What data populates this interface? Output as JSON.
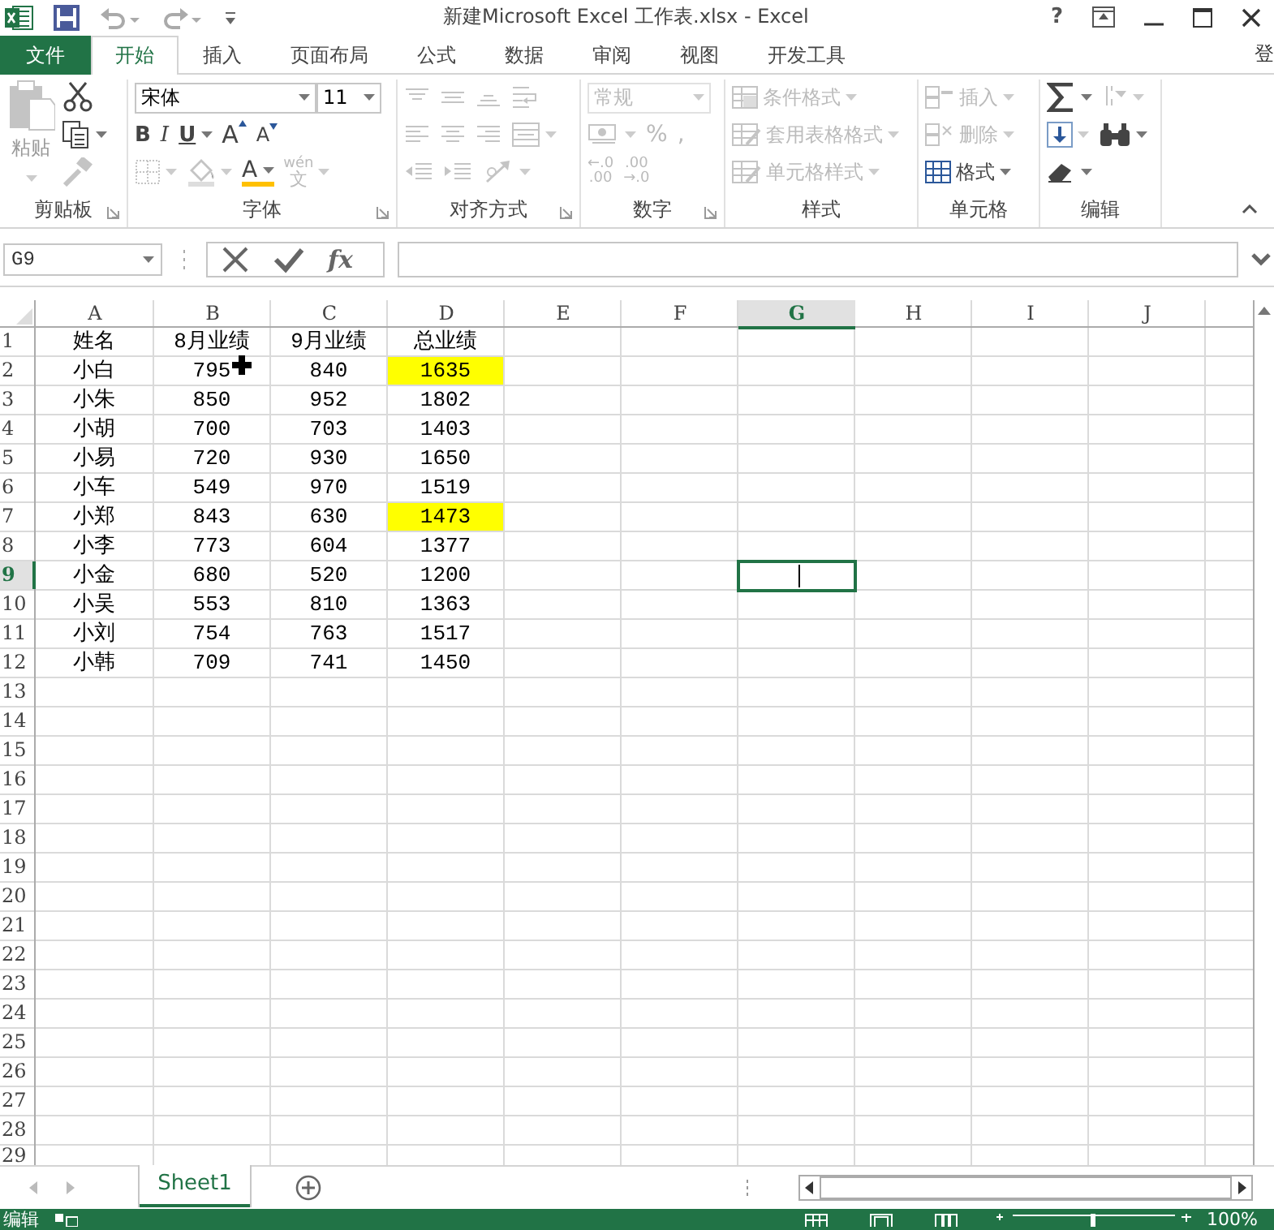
{
  "window": {
    "title": "新建Microsoft Excel 工作表.xlsx - Excel",
    "help": "?"
  },
  "tabs": [
    {
      "label": "文件",
      "kind": "file",
      "selected": false
    },
    {
      "label": "开始",
      "kind": "tab",
      "selected": true
    },
    {
      "label": "插入",
      "kind": "tab",
      "selected": false
    },
    {
      "label": "页面布局",
      "kind": "tab",
      "selected": false
    },
    {
      "label": "公式",
      "kind": "tab",
      "selected": false
    },
    {
      "label": "数据",
      "kind": "tab",
      "selected": false
    },
    {
      "label": "审阅",
      "kind": "tab",
      "selected": false
    },
    {
      "label": "视图",
      "kind": "tab",
      "selected": false
    },
    {
      "label": "开发工具",
      "kind": "tab",
      "selected": false
    }
  ],
  "account": {
    "label": "登"
  },
  "ribbon": {
    "groups": [
      {
        "label": "剪贴板",
        "launcher": true,
        "large": {
          "kind": "paste",
          "label": "粘贴",
          "disabled": true
        },
        "rows": [
          {
            "items": [
              {
                "kind": "cut",
                "disabled": false
              }
            ]
          },
          {
            "items": [
              {
                "kind": "copy",
                "disabled": false
              }
            ]
          },
          {
            "items": [
              {
                "kind": "painter",
                "disabled": true
              }
            ]
          }
        ]
      },
      {
        "label": "字体",
        "launcher": true,
        "rows": [
          {
            "items": [
              {
                "kind": "fontname",
                "value": "宋体",
                "disabled": false
              },
              {
                "kind": "fontsize",
                "value": "11",
                "disabled": false
              }
            ]
          },
          {
            "items": [
              {
                "kind": "bold",
                "label": "B",
                "disabled": false
              },
              {
                "kind": "italic",
                "label": "I",
                "disabled": false
              },
              {
                "kind": "underline",
                "label": "U",
                "disabled": false
              },
              {
                "kind": "grow",
                "label": "A",
                "disabled": false
              },
              {
                "kind": "shrink",
                "label": "A",
                "disabled": false
              }
            ]
          },
          {
            "items": [
              {
                "kind": "borders",
                "disabled": true
              },
              {
                "kind": "fill",
                "disabled": true
              },
              {
                "kind": "fontcolor",
                "label": "A",
                "disabled": false
              },
              {
                "kind": "phonetic",
                "label": "文",
                "ruby": "wén",
                "disabled": true
              }
            ]
          }
        ]
      },
      {
        "label": "对齐方式",
        "launcher": true,
        "rows": [
          {
            "items": [
              {
                "kind": "top",
                "disabled": true
              },
              {
                "kind": "middle",
                "disabled": true
              },
              {
                "kind": "bottom",
                "disabled": true
              },
              {
                "kind": "wrap",
                "disabled": true
              }
            ]
          },
          {
            "items": [
              {
                "kind": "left",
                "disabled": true
              },
              {
                "kind": "center",
                "disabled": true
              },
              {
                "kind": "right",
                "disabled": true
              },
              {
                "kind": "merge",
                "disabled": true
              }
            ]
          },
          {
            "items": [
              {
                "kind": "outdent",
                "disabled": true
              },
              {
                "kind": "indent",
                "disabled": true
              },
              {
                "kind": "orient",
                "disabled": true
              }
            ]
          }
        ]
      },
      {
        "label": "数字",
        "launcher": true,
        "rows": [
          {
            "items": [
              {
                "kind": "format",
                "value": "常规",
                "disabled": true
              }
            ]
          },
          {
            "items": [
              {
                "kind": "currency",
                "disabled": true
              },
              {
                "kind": "percent",
                "label": "%",
                "disabled": true
              },
              {
                "kind": "comma",
                "label": ",",
                "disabled": true
              }
            ]
          },
          {
            "items": [
              {
                "kind": "decimal",
                "label": "←.0",
                "sub": ".00",
                "disabled": true
              },
              {
                "kind": "decimal",
                "label": ".00",
                "sub": "→.0",
                "disabled": true
              }
            ]
          }
        ]
      },
      {
        "label": "样式",
        "launcher": false,
        "rows": [
          {
            "items": [
              {
                "kind": "condformat",
                "label": "条件格式",
                "disabled": true
              }
            ]
          },
          {
            "items": [
              {
                "kind": "tableformat",
                "label": "套用表格格式",
                "disabled": true
              }
            ]
          },
          {
            "items": [
              {
                "kind": "cellstyle",
                "label": "单元格样式",
                "disabled": true
              }
            ]
          }
        ]
      },
      {
        "label": "单元格",
        "launcher": false,
        "rows": [
          {
            "items": [
              {
                "kind": "insert",
                "label": "插入",
                "disabled": true
              }
            ]
          },
          {
            "items": [
              {
                "kind": "delete",
                "label": "删除",
                "disabled": true
              }
            ]
          },
          {
            "items": [
              {
                "kind": "cellformat",
                "label": "格式",
                "disabled": false
              }
            ]
          }
        ]
      },
      {
        "label": "编辑",
        "launcher": false,
        "rows": [
          {
            "items": [
              {
                "kind": "sum",
                "disabled": false
              },
              {
                "kind": "sort",
                "disabled": true
              }
            ]
          },
          {
            "items": [
              {
                "kind": "fill",
                "disabled": true
              },
              {
                "kind": "find",
                "disabled": false
              }
            ]
          },
          {
            "items": [
              {
                "kind": "clear",
                "disabled": false
              }
            ]
          }
        ]
      }
    ]
  },
  "formula_bar": {
    "name_box": "G9",
    "fx": "fx"
  },
  "columns": [
    {
      "label": "A",
      "selected": false
    },
    {
      "label": "B",
      "selected": false
    },
    {
      "label": "C",
      "selected": false
    },
    {
      "label": "D",
      "selected": false
    },
    {
      "label": "E",
      "selected": false
    },
    {
      "label": "F",
      "selected": false
    },
    {
      "label": "G",
      "selected": true
    },
    {
      "label": "H",
      "selected": false
    },
    {
      "label": "I",
      "selected": false
    },
    {
      "label": "J",
      "selected": false
    }
  ],
  "rows": [
    {
      "label": "1",
      "selected": false,
      "cells": [
        {
          "text": "姓名"
        },
        {
          "text": "8月业绩"
        },
        {
          "text": "9月业绩"
        },
        {
          "text": "总业绩"
        }
      ]
    },
    {
      "label": "2",
      "selected": false,
      "cells": [
        {
          "text": "小白"
        },
        {
          "text": "795"
        },
        {
          "text": "840"
        },
        {
          "text": "1635",
          "color": "#ffff00"
        }
      ]
    },
    {
      "label": "3",
      "selected": false,
      "cells": [
        {
          "text": "小朱"
        },
        {
          "text": "850"
        },
        {
          "text": "952"
        },
        {
          "text": "1802"
        }
      ]
    },
    {
      "label": "4",
      "selected": false,
      "cells": [
        {
          "text": "小胡"
        },
        {
          "text": "700"
        },
        {
          "text": "703"
        },
        {
          "text": "1403"
        }
      ]
    },
    {
      "label": "5",
      "selected": false,
      "cells": [
        {
          "text": "小易"
        },
        {
          "text": "720"
        },
        {
          "text": "930"
        },
        {
          "text": "1650"
        }
      ]
    },
    {
      "label": "6",
      "selected": false,
      "cells": [
        {
          "text": "小车"
        },
        {
          "text": "549"
        },
        {
          "text": "970"
        },
        {
          "text": "1519"
        }
      ]
    },
    {
      "label": "7",
      "selected": false,
      "cells": [
        {
          "text": "小郑"
        },
        {
          "text": "843"
        },
        {
          "text": "630"
        },
        {
          "text": "1473",
          "color": "#ffff00"
        }
      ]
    },
    {
      "label": "8",
      "selected": false,
      "cells": [
        {
          "text": "小李"
        },
        {
          "text": "773"
        },
        {
          "text": "604"
        },
        {
          "text": "1377"
        }
      ]
    },
    {
      "label": "9",
      "selected": true,
      "cells": [
        {
          "text": "小金"
        },
        {
          "text": "680"
        },
        {
          "text": "520"
        },
        {
          "text": "1200"
        }
      ]
    },
    {
      "label": "10",
      "selected": false,
      "cells": [
        {
          "text": "小吴"
        },
        {
          "text": "553"
        },
        {
          "text": "810"
        },
        {
          "text": "1363"
        }
      ]
    },
    {
      "label": "11",
      "selected": false,
      "cells": [
        {
          "text": "小刘"
        },
        {
          "text": "754"
        },
        {
          "text": "763"
        },
        {
          "text": "1517"
        }
      ]
    },
    {
      "label": "12",
      "selected": false,
      "cells": [
        {
          "text": "小韩"
        },
        {
          "text": "709"
        },
        {
          "text": "741"
        },
        {
          "text": "1450"
        }
      ]
    },
    {
      "label": "13",
      "selected": false
    },
    {
      "label": "14",
      "selected": false
    },
    {
      "label": "15",
      "selected": false
    },
    {
      "label": "16",
      "selected": false
    },
    {
      "label": "17",
      "selected": false
    },
    {
      "label": "18",
      "selected": false
    },
    {
      "label": "19",
      "selected": false
    },
    {
      "label": "20",
      "selected": false
    },
    {
      "label": "21",
      "selected": false
    },
    {
      "label": "22",
      "selected": false
    },
    {
      "label": "23",
      "selected": false
    },
    {
      "label": "24",
      "selected": false
    },
    {
      "label": "25",
      "selected": false
    },
    {
      "label": "26",
      "selected": false
    },
    {
      "label": "27",
      "selected": false
    },
    {
      "label": "28",
      "selected": false
    },
    {
      "label": "29",
      "selected": false
    }
  ],
  "sheet_tabs": [
    {
      "label": "Sheet1",
      "selected": true
    }
  ],
  "status_bar": {
    "mode": "编辑",
    "zoom": "100%"
  }
}
